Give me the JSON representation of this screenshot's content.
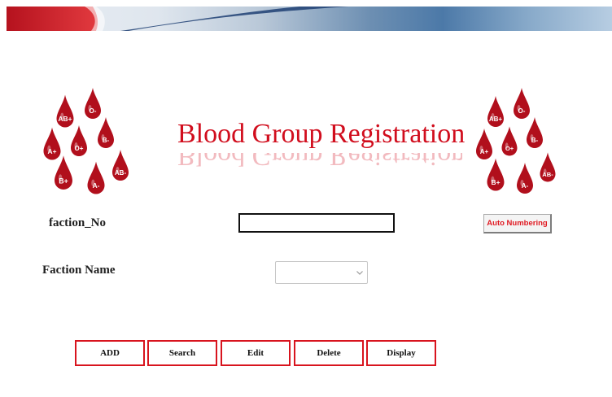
{
  "title": "Blood Group Registration",
  "fields": {
    "faction_no_label": "faction_No",
    "faction_no_value": "",
    "faction_name_label": "Faction Name",
    "faction_name_selected": ""
  },
  "auto_numbering_label": "Auto Numbering",
  "buttons": {
    "add": "ADD",
    "search": "Search",
    "edit": "Edit",
    "delete": "Delete",
    "display": "Display"
  },
  "blood_types": [
    "AB+",
    "O-",
    "A+",
    "O+",
    "B-",
    "B+",
    "A-",
    "AB-"
  ],
  "colors": {
    "title": "#d10d1d",
    "button_border": "#d8141e",
    "drop": "#b10f1c"
  },
  "icons": {
    "left_drops": "blood-drops-icon",
    "right_drops": "blood-drops-icon",
    "select_arrow": "chevron-down-icon"
  }
}
